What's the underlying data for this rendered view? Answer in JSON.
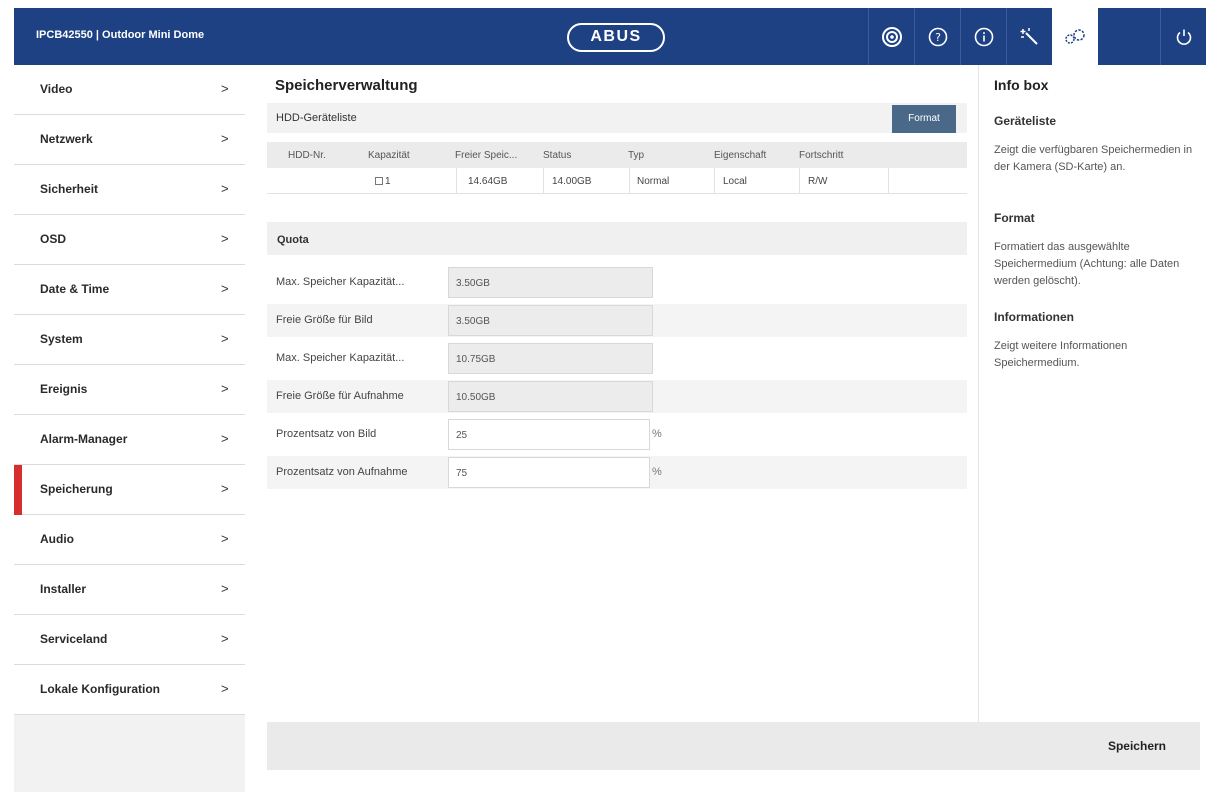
{
  "header": {
    "title": "IPCB42550 | Outdoor Mini Dome",
    "logo": "ABUS",
    "buttons": [
      {
        "icon": "live-view-icon"
      },
      {
        "icon": "help-icon"
      },
      {
        "icon": "info-icon"
      },
      {
        "icon": "wizard-icon"
      },
      {
        "icon": "settings-icon",
        "active": true
      },
      {
        "icon": "power-icon"
      }
    ]
  },
  "sidebar": {
    "items": [
      {
        "label": "Video",
        "chevron": ">"
      },
      {
        "label": "Netzwerk",
        "chevron": ">"
      },
      {
        "label": "Sicherheit",
        "chevron": ">"
      },
      {
        "label": "OSD",
        "chevron": ">"
      },
      {
        "label": "Date & Time",
        "chevron": ">"
      },
      {
        "label": "System",
        "chevron": ">"
      },
      {
        "label": "Ereignis",
        "chevron": ">"
      },
      {
        "label": "Alarm-Manager",
        "chevron": ">"
      },
      {
        "label": "Speicherung",
        "chevron": ">",
        "active": true
      },
      {
        "label": "Audio",
        "chevron": ">"
      },
      {
        "label": "Installer",
        "chevron": ">"
      },
      {
        "label": "Serviceland",
        "chevron": ">"
      },
      {
        "label": "Lokale Konfiguration",
        "chevron": ">"
      }
    ]
  },
  "main": {
    "title": "Speicherverwaltung",
    "hdd_list_label": "HDD-Geräteliste",
    "format_button": "Format",
    "table": {
      "headers": [
        "HDD-Nr.",
        "Kapazität",
        "Freier Speic...",
        "Status",
        "Typ",
        "Eigenschaft",
        "Fortschritt"
      ],
      "rows": [
        {
          "hdd_nr": "1",
          "kapazitaet": "14.64GB",
          "freier_speicher": "14.00GB",
          "status": "Normal",
          "typ": "Local",
          "eigenschaft": "R/W",
          "fortschritt": ""
        }
      ]
    },
    "quota": {
      "label": "Quota",
      "fields": [
        {
          "label": "Max. Speicher Kapazität...",
          "value": "3.50GB",
          "editable": false
        },
        {
          "label": "Freie Größe für Bild",
          "value": "3.50GB",
          "editable": false
        },
        {
          "label": "Max. Speicher Kapazität...",
          "value": "10.75GB",
          "editable": false
        },
        {
          "label": "Freie Größe für Aufnahme",
          "value": "10.50GB",
          "editable": false
        },
        {
          "label": "Prozentsatz von Bild",
          "value": "25",
          "unit": "%",
          "editable": true
        },
        {
          "label": "Prozentsatz von Aufnahme",
          "value": "75",
          "unit": "%",
          "editable": true
        }
      ]
    },
    "save_button": "Speichern"
  },
  "info_box": {
    "title": "Info box",
    "sections": [
      {
        "heading": "Geräteliste",
        "text": "Zeigt die verfügbaren Speichermedien in der Kamera (SD-Karte) an."
      },
      {
        "heading": "Format",
        "text": "Formatiert das ausgewählte Speichermedium (Achtung: alle Daten werden gelöscht)."
      },
      {
        "heading": "Informationen",
        "text": "Zeigt weitere Informationen Speichermedium."
      }
    ]
  },
  "colors": {
    "header_bg": "#1d4183",
    "active_marker": "#d62e2e",
    "format_button_bg": "#4a6989"
  }
}
